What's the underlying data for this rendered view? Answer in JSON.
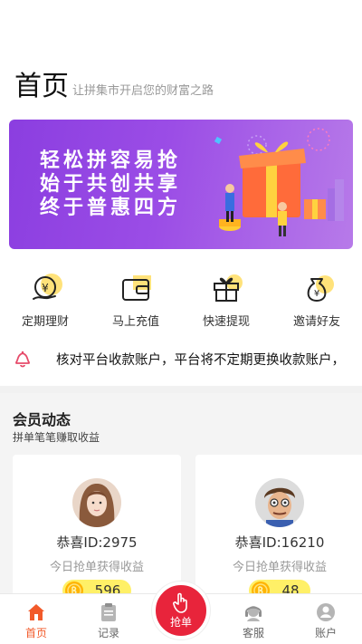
{
  "header": {
    "title": "首页",
    "subtitle": "让拼集市开启您的财富之路"
  },
  "banner": {
    "lines": [
      "轻松拼容易抢",
      "始于共创共享",
      "终于普惠四方"
    ]
  },
  "quick_actions": [
    {
      "label": "定期理财",
      "icon": "money-bag-icon"
    },
    {
      "label": "马上充值",
      "icon": "wallet-icon"
    },
    {
      "label": "快速提现",
      "icon": "gift-icon"
    },
    {
      "label": "邀请好友",
      "icon": "money-pouch-icon"
    }
  ],
  "notice": {
    "text": "核对平台收款账户，平台将不定期更换收款账户，"
  },
  "members": {
    "title": "会员动态",
    "subtitle": "拼单笔笔赚取收益",
    "cards": [
      {
        "name": "恭喜ID:2975",
        "desc": "今日抢单获得收益",
        "amount": "596"
      },
      {
        "name": "恭喜ID:16210",
        "desc": "今日抢单获得收益",
        "amount": "48"
      }
    ]
  },
  "tabbar": {
    "home": "首页",
    "records": "记录",
    "grab": "抢单",
    "service": "客服",
    "account": "账户"
  },
  "colors": {
    "accent": "#f25a2a",
    "grab": "#e8243b",
    "banner": "#9b4de6",
    "coin_badge": "#fff067"
  }
}
